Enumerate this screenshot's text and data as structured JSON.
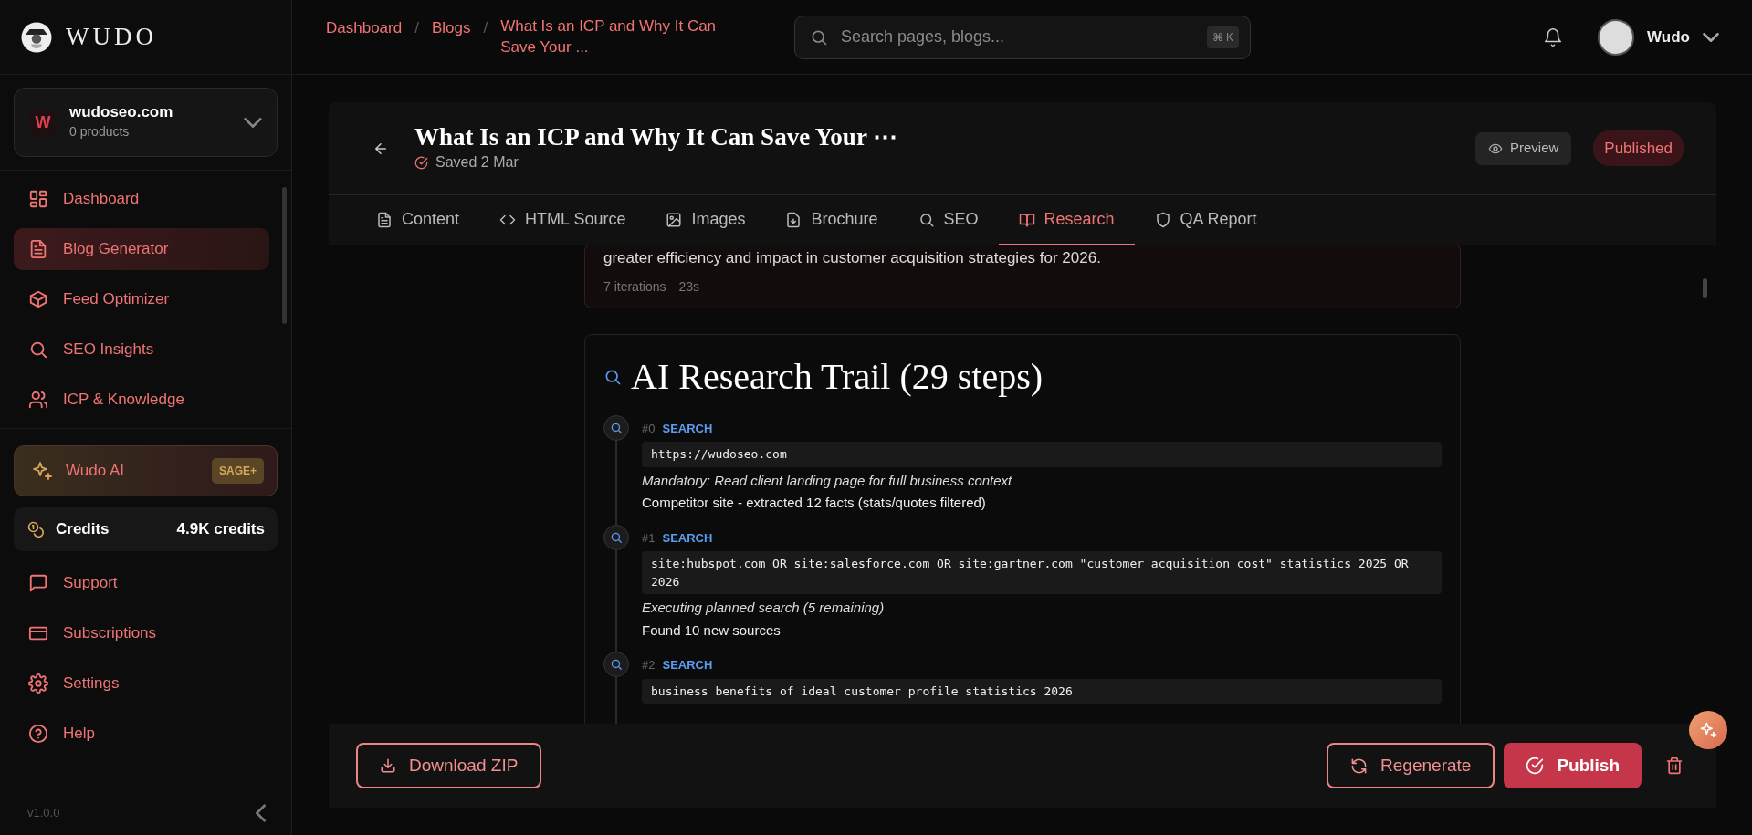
{
  "brand": {
    "name": "WUDO"
  },
  "workspace": {
    "initial": "W",
    "name": "wudoseo.com",
    "subtitle": "0 products"
  },
  "nav": [
    {
      "label": "Dashboard",
      "selected": false
    },
    {
      "label": "Blog Generator",
      "selected": true
    },
    {
      "label": "Feed Optimizer",
      "selected": false
    },
    {
      "label": "SEO Insights",
      "selected": false
    },
    {
      "label": "ICP & Knowledge",
      "selected": false
    }
  ],
  "ai": {
    "label": "Wudo AI",
    "badge": "SAGE+"
  },
  "credits": {
    "label": "Credits",
    "value": "4.9K credits"
  },
  "bottom_nav": [
    {
      "label": "Support"
    },
    {
      "label": "Subscriptions"
    },
    {
      "label": "Settings"
    },
    {
      "label": "Help"
    }
  ],
  "version": "v1.0.0",
  "breadcrumbs": [
    {
      "label": "Dashboard"
    },
    {
      "separator": "/",
      "label": "Blogs"
    },
    {
      "separator": "/",
      "label": "What Is an ICP and Why It Can Save Your ..."
    }
  ],
  "search": {
    "placeholder": "Search pages, blogs...",
    "shortcut": "⌘ K"
  },
  "user": {
    "name": "Wudo"
  },
  "editor": {
    "title": "What Is an ICP and Why It Can Save Your ⋯",
    "status": "Saved 2 Mar",
    "preview": "Preview",
    "badge": "Published",
    "tabs": [
      {
        "label": "Content",
        "selected": false
      },
      {
        "label": "HTML Source",
        "selected": false
      },
      {
        "label": "Images",
        "selected": false
      },
      {
        "label": "Brochure",
        "selected": false
      },
      {
        "label": "SEO",
        "selected": false
      },
      {
        "label": "Research",
        "selected": true
      },
      {
        "label": "QA Report",
        "selected": false
      }
    ]
  },
  "summary": {
    "text": "greater efficiency and impact in customer acquisition strategies for 2026.",
    "iterations": "7 iterations",
    "duration": "23s"
  },
  "trail": {
    "title": "AI Research Trail (29 steps)",
    "steps": [
      {
        "number": "#0",
        "type": "SEARCH",
        "query": "https://wudoseo.com",
        "reason": "Mandatory: Read client landing page for full business context",
        "result": "Competitor site - extracted 12 facts (stats/quotes filtered)"
      },
      {
        "number": "#1",
        "type": "SEARCH",
        "query": "site:hubspot.com OR site:salesforce.com OR site:gartner.com \"customer acquisition cost\" statistics 2025 OR 2026",
        "reason": "Executing planned search (5 remaining)",
        "result": "Found 10 new sources"
      },
      {
        "number": "#2",
        "type": "SEARCH",
        "query": "business benefits of ideal customer profile statistics 2026"
      }
    ]
  },
  "actions": {
    "download": "Download ZIP",
    "regenerate": "Regenerate",
    "publish": "Publish"
  }
}
